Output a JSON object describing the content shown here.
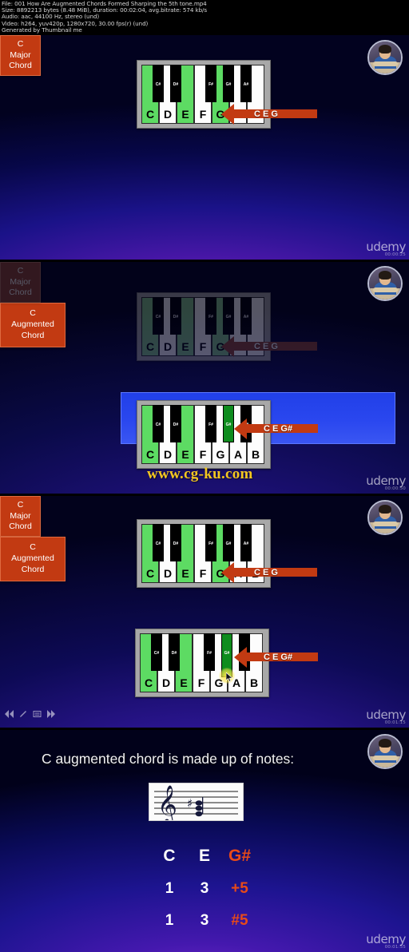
{
  "meta": {
    "lines": [
      "File: 001 How Are Augmented Chords Formed Sharping the 5th tone.mp4",
      "Size: 8892213 bytes (8.48 MiB), duration: 00:02:04, avg.bitrate: 574 kb/s",
      "Audio: aac, 44100 Hz, stereo (und)",
      "Video: h264, yuv420p, 1280x720, 30.00 fps(r) (und)",
      "Generated by Thumbnail me"
    ]
  },
  "keyboard": {
    "white_keys": [
      "C",
      "D",
      "E",
      "F",
      "G",
      "A",
      "B"
    ],
    "black_keys": [
      "C#",
      "D#",
      "F#",
      "G#",
      "A#"
    ],
    "major_highlight": [
      "C",
      "E",
      "G"
    ],
    "augmented_highlight_white": [
      "C",
      "E"
    ],
    "augmented_highlight_black": [
      "G#"
    ]
  },
  "frames": [
    {
      "index": 1,
      "arrow_label": "C E G",
      "chord_title": "C",
      "chord_line2": "Major",
      "chord_line3": "Chord",
      "timestamp": "00:00:25",
      "state": "normal"
    },
    {
      "index": 2,
      "arrow_label": "C E G",
      "chord_title": "C",
      "chord_line2": "Major",
      "chord_line3": "Chord",
      "state": "dimmed"
    },
    {
      "index": 3,
      "arrow_label": "C E G#",
      "chord_title": "C",
      "chord_line2": "Augmented",
      "chord_line3": "Chord",
      "timestamp": "00:00:50",
      "state": "highlighted",
      "watermark": "www.cg-ku.com"
    },
    {
      "index": 4,
      "arrow_label": "C E G",
      "chord_title": "C",
      "chord_line2": "Major",
      "chord_line3": "Chord",
      "state": "normal"
    },
    {
      "index": 5,
      "arrow_label": "C E G#",
      "chord_title": "C",
      "chord_line2": "Augmented",
      "chord_line3": "Chord",
      "timestamp": "00:01:15",
      "state": "normal"
    }
  ],
  "summary_slide": {
    "title": "C augmented chord is made up of notes:",
    "staff_clef": "treble-clef",
    "rows": [
      [
        "C",
        "E",
        "G#"
      ],
      [
        "1",
        "3",
        "+5"
      ],
      [
        "1",
        "3",
        "#5"
      ]
    ],
    "timestamp": "00:01:55"
  },
  "brand": {
    "name": "udemy"
  },
  "colors": {
    "chord_box": "#c23a12",
    "key_highlight": "#5ddb63",
    "black_key_highlight": "#0e8c1e",
    "accent_red": "#e84a18",
    "watermark_gold": "#f3c720",
    "frame_highlight": "#2a47ef"
  }
}
